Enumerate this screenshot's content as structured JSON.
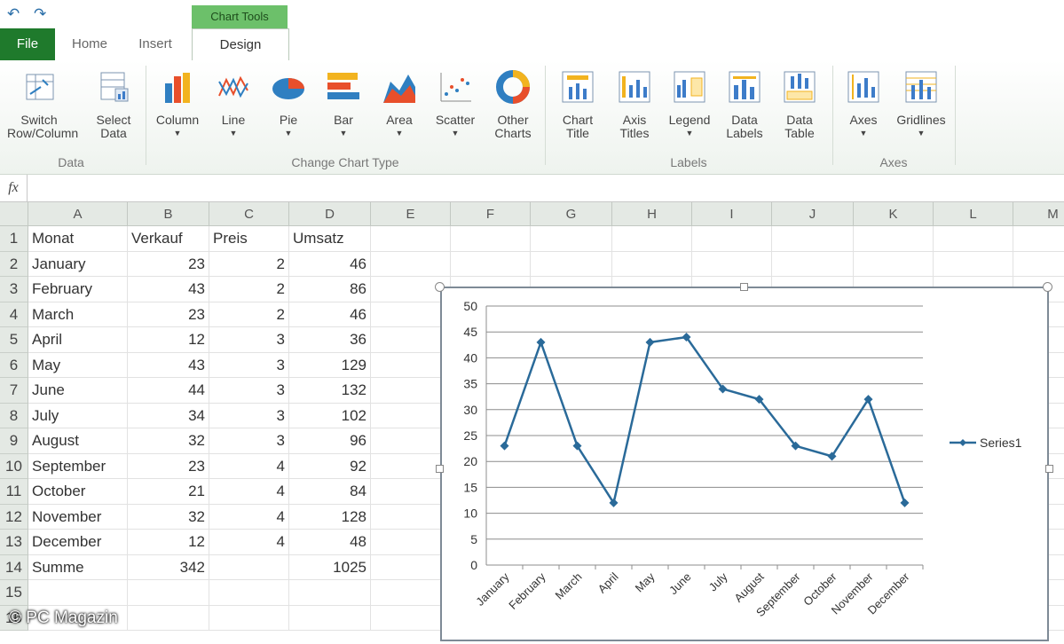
{
  "quick_access": {
    "undo_icon": "undo-icon",
    "redo_icon": "redo-icon"
  },
  "context_tab": "Chart Tools",
  "tabs": {
    "file": "File",
    "home": "Home",
    "insert": "Insert",
    "design": "Design"
  },
  "ribbon": {
    "groups": {
      "data": "Data",
      "change_type": "Change Chart Type",
      "labels": "Labels",
      "axes": "Axes"
    },
    "buttons": {
      "switch": "Switch Row/Column",
      "select": "Select Data",
      "column": "Column",
      "line": "Line",
      "pie": "Pie",
      "bar": "Bar",
      "area": "Area",
      "scatter": "Scatter",
      "other": "Other Charts",
      "chart_title": "Chart Title",
      "axis_titles": "Axis Titles",
      "legend": "Legend",
      "data_labels": "Data Labels",
      "data_table": "Data Table",
      "axes": "Axes",
      "gridlines": "Gridlines"
    }
  },
  "formula_bar": {
    "fx": "fx",
    "value": ""
  },
  "columns": [
    "A",
    "B",
    "C",
    "D",
    "E",
    "F",
    "G",
    "H",
    "I",
    "J",
    "K",
    "L",
    "M"
  ],
  "rows": [
    "1",
    "2",
    "3",
    "4",
    "5",
    "6",
    "7",
    "8",
    "9",
    "10",
    "11",
    "12",
    "13",
    "14",
    "15",
    "16"
  ],
  "table": {
    "headers": [
      "Monat",
      "Verkauf",
      "Preis",
      "Umsatz"
    ],
    "data": [
      [
        "January",
        "23",
        "2",
        "46"
      ],
      [
        "February",
        "43",
        "2",
        "86"
      ],
      [
        "March",
        "23",
        "2",
        "46"
      ],
      [
        "April",
        "12",
        "3",
        "36"
      ],
      [
        "May",
        "43",
        "3",
        "129"
      ],
      [
        "June",
        "44",
        "3",
        "132"
      ],
      [
        "July",
        "34",
        "3",
        "102"
      ],
      [
        "August",
        "32",
        "3",
        "96"
      ],
      [
        "September",
        "23",
        "4",
        "92"
      ],
      [
        "October",
        "21",
        "4",
        "84"
      ],
      [
        "November",
        "32",
        "4",
        "128"
      ],
      [
        "December",
        "12",
        "4",
        "48"
      ]
    ],
    "total": [
      "Summe",
      "342",
      "",
      "1025"
    ]
  },
  "chart_data": {
    "type": "line",
    "categories": [
      "January",
      "February",
      "March",
      "April",
      "May",
      "June",
      "July",
      "August",
      "September",
      "October",
      "November",
      "December"
    ],
    "series": [
      {
        "name": "Series1",
        "values": [
          23,
          43,
          23,
          12,
          43,
          44,
          34,
          32,
          23,
          21,
          32,
          12
        ]
      }
    ],
    "ylim": [
      0,
      50
    ],
    "yticks": [
      "0",
      "5",
      "10",
      "15",
      "20",
      "25",
      "30",
      "35",
      "40",
      "45",
      "50"
    ],
    "grid": true,
    "legend": "right",
    "title": "",
    "xlabel": "",
    "ylabel": "",
    "line_color": "#2a6a99"
  },
  "watermark": "© PC Magazin"
}
